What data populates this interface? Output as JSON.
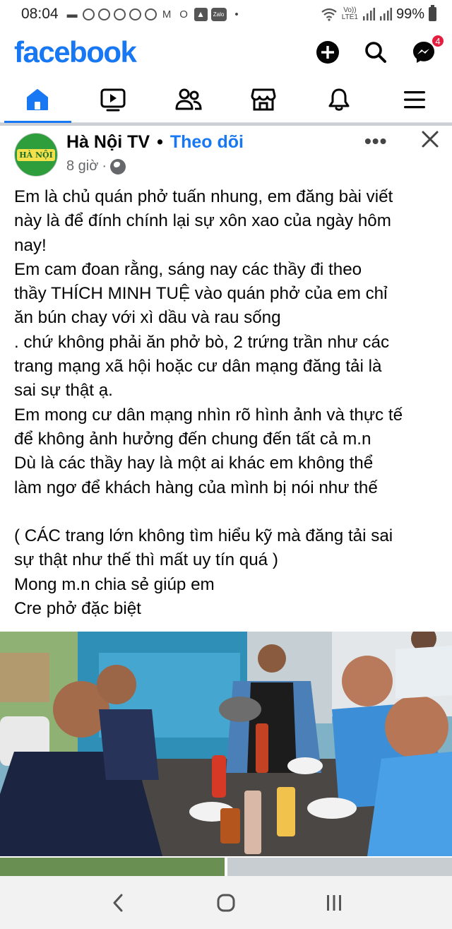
{
  "status_bar": {
    "time": "08:04",
    "lte_top": "Vo))",
    "lte_bottom": "LTE1",
    "battery": "99%",
    "icons": [
      "message-icon",
      "chrome-icon",
      "chrome-icon",
      "chrome-icon",
      "chrome-icon",
      "chrome-icon",
      "gmail-icon",
      "opera-icon",
      "gallery-icon",
      "zalo-icon",
      "dot-icon"
    ],
    "zalo_label": "Zalo"
  },
  "header": {
    "logo": "facebook",
    "badge_count": "4"
  },
  "nav_tabs": [
    "home",
    "video",
    "friends",
    "marketplace",
    "notifications",
    "menu"
  ],
  "post": {
    "page_name": "Hà Nội TV",
    "separator": "•",
    "follow": "Theo dõi",
    "time": "8 giờ",
    "time_sep": "·",
    "more": "•••",
    "avatar_text": "HÀ NỘI",
    "lines": [
      "Em là chủ quán phở tuấn nhung, em đăng bài viết",
      "này là để đính chính lại sự xôn xao của ngày hôm",
      "nay!",
      "Em cam đoan rằng, sáng nay các thầy đi theo",
      "thầy THÍCH MINH TUỆ vào quán phở của em chỉ",
      "ăn bún chay với xì dầu và rau sống",
      ". chứ không phải ăn phở bò, 2 trứng trần như các",
      "trang mạng xã hội hoặc cư dân mạng đăng tải là",
      "sai sự thật ạ.",
      "Em mong cư dân mạng nhìn rõ hình ảnh và thực tế",
      "để không ảnh hưởng đến chung đến tất cả m.n",
      "Dù là các thầy hay là một ai khác em không thể",
      "làm ngơ để khách hàng của mình bị nói như thế",
      "",
      "( CÁC trang lớn không tìm hiểu kỹ mà đăng tải sai",
      "sự thật như thế thì mất uy tín quá )",
      "Mong m.n chia sẻ giúp em",
      "Cre phở đặc biệt"
    ]
  },
  "colors": {
    "brand": "#1877f2",
    "badge": "#e41e3f",
    "text": "#050505",
    "meta": "#65676b"
  }
}
